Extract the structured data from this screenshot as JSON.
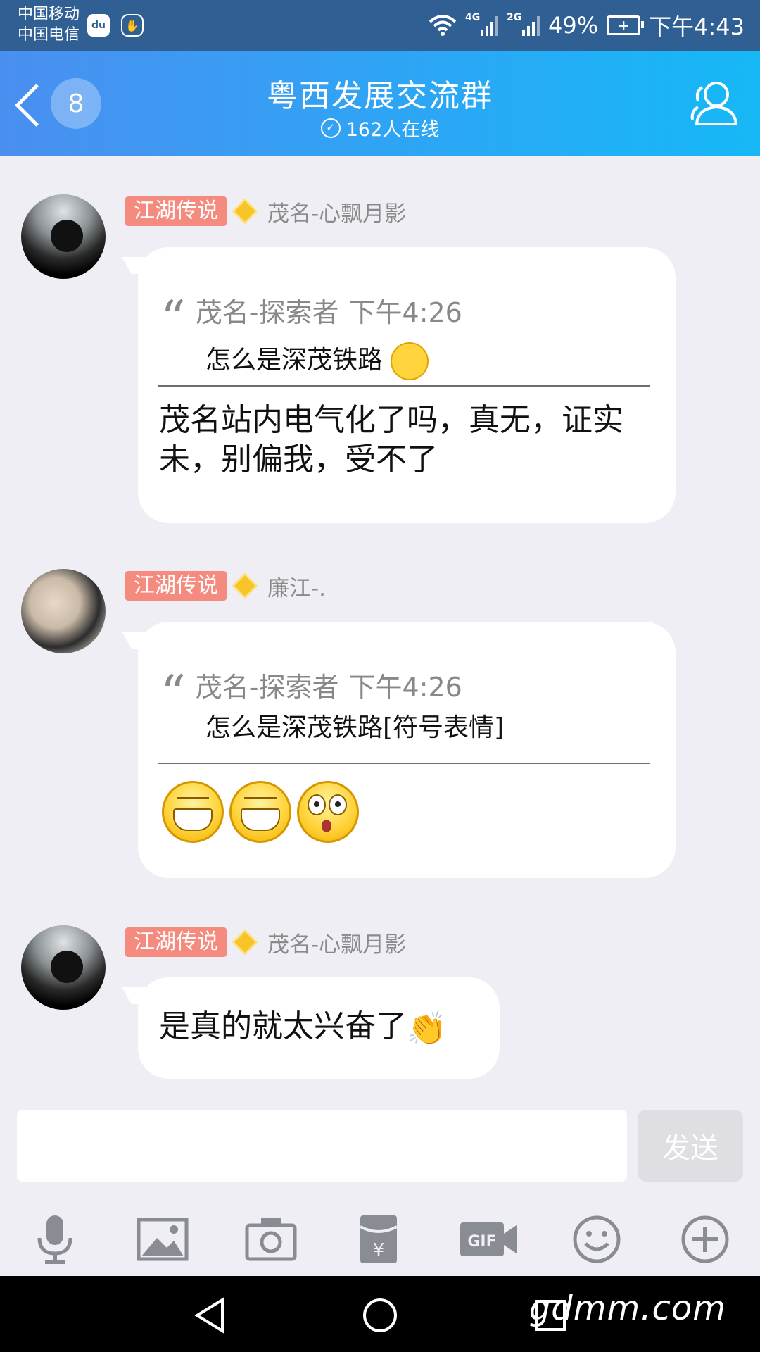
{
  "status_bar": {
    "carrier_1": "中国移动",
    "carrier_2": "中国电信",
    "net_1": "4G",
    "net_2": "2G",
    "battery_pct": "49%",
    "time": "下午4:43"
  },
  "header": {
    "unread_count": "8",
    "title": "粤西发展交流群",
    "online": "162人在线"
  },
  "messages": [
    {
      "level": "江湖传说",
      "sender": "茂名-心飘月影",
      "quote": {
        "author": "茂名-探索者",
        "time": "下午4:26",
        "text": "怎么是深茂铁路"
      },
      "text": "茂名站内电气化了吗，真无，证实未，别偏我，受不了"
    },
    {
      "level": "江湖传说",
      "sender": "廉江-.",
      "quote": {
        "author": "茂名-探索者",
        "time": "下午4:26",
        "text": "怎么是深茂铁路[符号表情]"
      },
      "emojis": [
        "grin-emoji",
        "grin-emoji",
        "shocked-emoji"
      ]
    },
    {
      "level": "江湖传说",
      "sender": "茂名-心飘月影",
      "text": "是真的就太兴奋了"
    }
  ],
  "composer": {
    "input_value": "",
    "send_label": "发送"
  },
  "toolbar_icons": [
    "microphone-icon",
    "image-icon",
    "camera-icon",
    "red-packet-icon",
    "gif-icon",
    "emoji-icon",
    "plus-icon"
  ],
  "watermark": "gdmm.com",
  "colors": {
    "header_gradient_start": "#4a8ff0",
    "header_gradient_end": "#16b8f6",
    "level_badge": "#f58a7e",
    "chat_background": "#eeeef4"
  }
}
